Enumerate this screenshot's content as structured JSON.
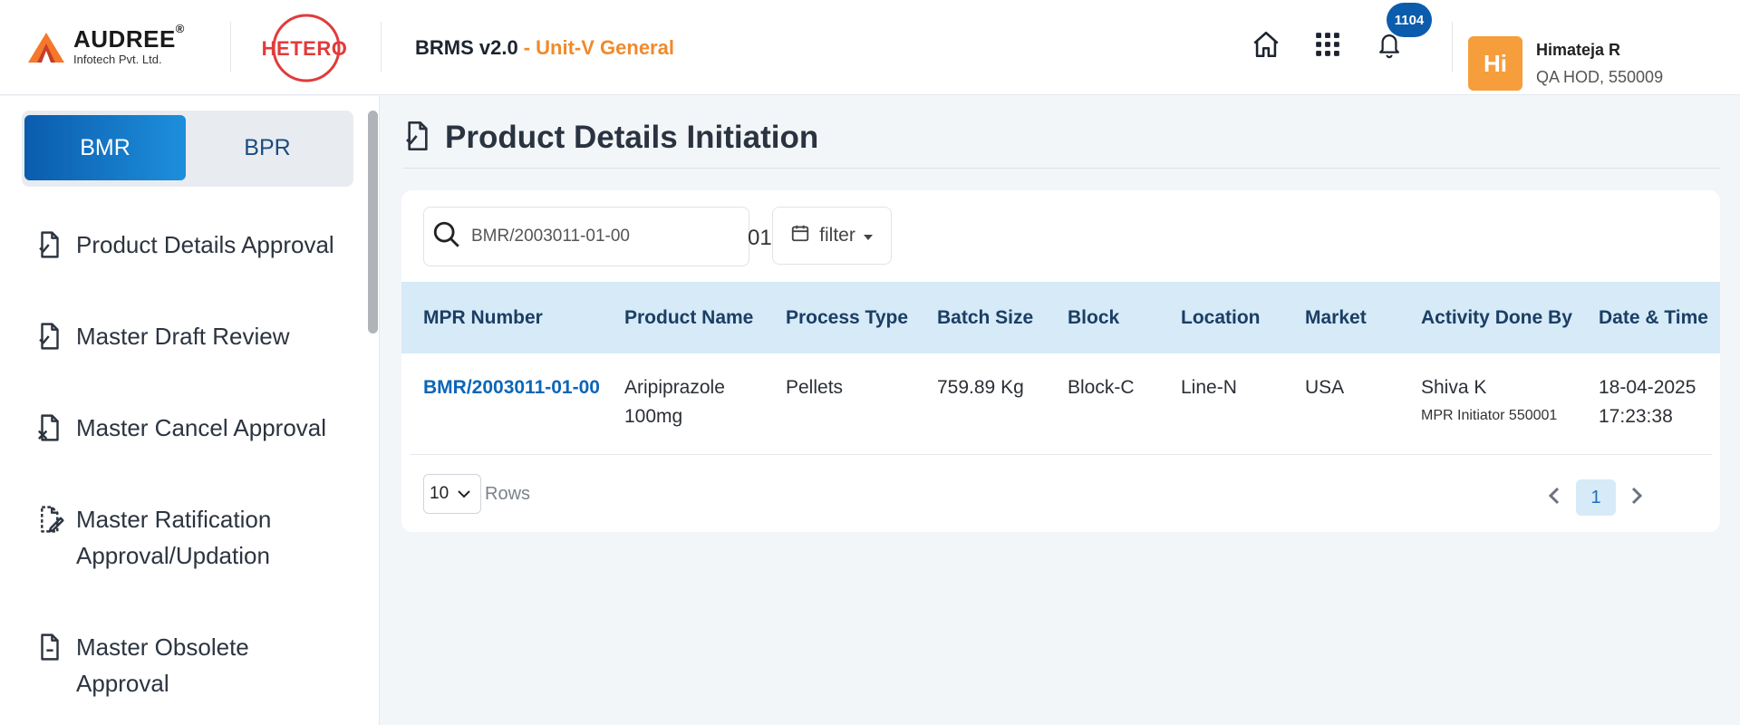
{
  "header": {
    "brand_name": "AUDREE",
    "brand_reg": "®",
    "brand_sub": "Infotech Pvt. Ltd.",
    "partner_logo": "HETERO",
    "app_title": "BRMS v2.0",
    "app_subtitle": "- Unit-V General",
    "notification_count": "1104",
    "user": {
      "initials": "Hi",
      "name": "Himateja R",
      "role": "QA HOD, 550009"
    },
    "icons": [
      "home-icon",
      "apps-grid-icon",
      "bell-icon"
    ]
  },
  "sidebar": {
    "toggle": [
      "BMR",
      "BPR"
    ],
    "active_toggle": "BMR",
    "items": [
      {
        "label": "Product Details Approval",
        "icon": "document-check-icon"
      },
      {
        "label": "Master Draft Review",
        "icon": "document-check-icon"
      },
      {
        "label": "Master Cancel Approval",
        "icon": "document-cancel-icon"
      },
      {
        "label": "Master Ratification\nApproval/Updation",
        "icon": "document-edit-icon"
      },
      {
        "label": "Master Obsolete Approval",
        "icon": "document-minus-icon"
      }
    ]
  },
  "main": {
    "page_title": "Product Details Initiation",
    "search": {
      "value": "BMR/2003011-01-00",
      "placeholder": "Search"
    },
    "stray_text": "01",
    "filter_label": "filter",
    "table": {
      "columns": [
        "MPR Number",
        "Product Name",
        "Process Type",
        "Batch Size",
        "Block",
        "Location",
        "Market",
        "Activity Done By",
        "Date & Time"
      ],
      "rows": [
        {
          "mpr_number": "BMR/2003011-01-00",
          "product_name": "Aripiprazole\n100mg",
          "process_type": "Pellets",
          "batch_size": "759.89 Kg",
          "block": "Block-C",
          "location": "Line-N",
          "market": "USA",
          "activity_by": "Shiva K",
          "activity_by_role": "MPR Initiator 550001",
          "date": "18-04-2025",
          "time": "17:23:38"
        }
      ]
    },
    "pagination": {
      "rows_per_page": "10",
      "rows_label": "Rows",
      "current_page": "1"
    }
  },
  "colors": {
    "primary": "#0b5cad",
    "accent_orange": "#f08a2c",
    "table_header_bg": "#d6eaf8",
    "avatar_bg": "#f59e3b",
    "hetero_red": "#e23b3b"
  }
}
